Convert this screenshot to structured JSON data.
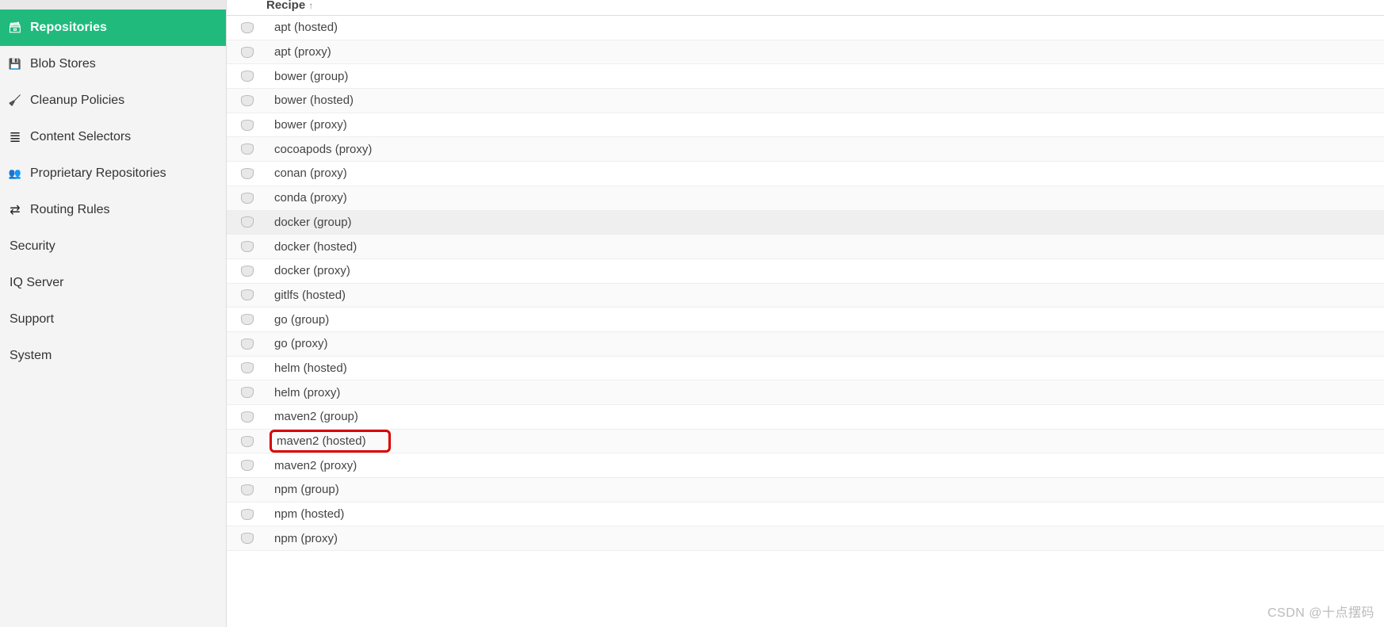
{
  "sidebar": {
    "groups": [
      {
        "label": "Repositories",
        "active": true,
        "icon": "ic-repo"
      },
      {
        "label": "Blob Stores",
        "icon": "ic-blob"
      },
      {
        "label": "Cleanup Policies",
        "icon": "ic-broom"
      },
      {
        "label": "Content Selectors",
        "icon": "ic-layers"
      },
      {
        "label": "Proprietary Repositories",
        "icon": "ic-prop"
      },
      {
        "label": "Routing Rules",
        "icon": "ic-route"
      }
    ],
    "plain": [
      {
        "label": "Security"
      },
      {
        "label": "IQ Server"
      },
      {
        "label": "Support"
      },
      {
        "label": "System"
      }
    ]
  },
  "table": {
    "header": "Recipe",
    "rows": [
      {
        "label": "apt (hosted)"
      },
      {
        "label": "apt (proxy)"
      },
      {
        "label": "bower (group)"
      },
      {
        "label": "bower (hosted)"
      },
      {
        "label": "bower (proxy)"
      },
      {
        "label": "cocoapods (proxy)"
      },
      {
        "label": "conan (proxy)"
      },
      {
        "label": "conda (proxy)"
      },
      {
        "label": "docker (group)",
        "hovered": true
      },
      {
        "label": "docker (hosted)"
      },
      {
        "label": "docker (proxy)"
      },
      {
        "label": "gitlfs (hosted)"
      },
      {
        "label": "go (group)"
      },
      {
        "label": "go (proxy)"
      },
      {
        "label": "helm (hosted)"
      },
      {
        "label": "helm (proxy)"
      },
      {
        "label": "maven2 (group)"
      },
      {
        "label": "maven2 (hosted)",
        "highlighted": true
      },
      {
        "label": "maven2 (proxy)"
      },
      {
        "label": "npm (group)"
      },
      {
        "label": "npm (hosted)"
      },
      {
        "label": "npm (proxy)"
      }
    ]
  },
  "watermark": "CSDN @十点摆码"
}
